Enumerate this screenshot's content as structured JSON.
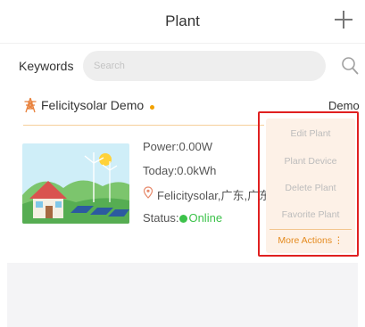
{
  "colors": {
    "accent": "#f2a100",
    "online": "#3cc24a",
    "highlight_border": "#e02020",
    "menu_bg": "#fdf1e7",
    "more_actions_text": "#e58a1e"
  },
  "header": {
    "title": "Plant",
    "add_icon": "plus-icon"
  },
  "search": {
    "label": "Keywords",
    "placeholder": "Search",
    "icon": "search-icon"
  },
  "plant": {
    "icon": "tower-icon",
    "name": "Felicitysolar Demo",
    "tag": "Demo",
    "power": "Power:0.00W",
    "today": "Today:0.0kWh",
    "location": "Felicitysolar,广东,广东",
    "status_label": "Status:",
    "status_value": "Online"
  },
  "action_menu": {
    "items": [
      "Edit Plant",
      "Plant Device",
      "Delete Plant",
      "Favorite Plant"
    ],
    "more": "More Actions",
    "more_icon": "vertical-dots-icon"
  }
}
